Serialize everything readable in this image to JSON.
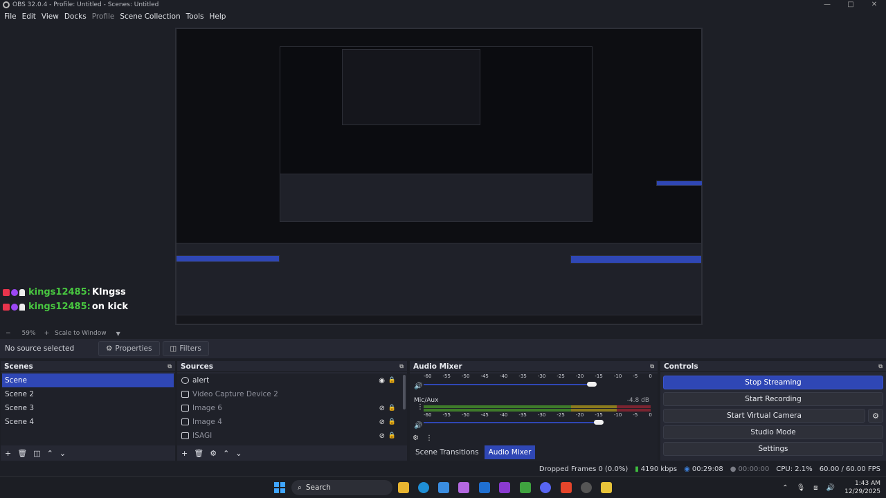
{
  "window": {
    "title": "OBS 32.0.4 - Profile: Untitled - Scenes: Untitled",
    "controls": [
      "—",
      "□",
      "✕"
    ]
  },
  "menu": [
    "File",
    "Edit",
    "View",
    "Docks",
    "Profile",
    "Scene Collection",
    "Tools",
    "Help"
  ],
  "chat": [
    {
      "user": "kings12485:",
      "message": "KIngss"
    },
    {
      "user": "kings12485:",
      "message": "on kick"
    }
  ],
  "scale": {
    "minus": "−",
    "zoom": "59%",
    "plus": "+",
    "mode": "Scale to Window"
  },
  "source_bar": {
    "no_source": "No source selected",
    "properties": "Properties",
    "filters": "Filters"
  },
  "scenes": {
    "title": "Scenes",
    "items": [
      "Scene",
      "Scene 2",
      "Scene 3",
      "Scene 4"
    ]
  },
  "sources": {
    "title": "Sources",
    "items": [
      "alert",
      "Video Capture Device 2",
      "Image 6",
      "Image 4",
      "ISAGI"
    ]
  },
  "mixer": {
    "title": "Audio Mixer",
    "ticks": [
      "-60",
      "-55",
      "-50",
      "-45",
      "-40",
      "-35",
      "-30",
      "-25",
      "-20",
      "-15",
      "-10",
      "-5",
      "0"
    ],
    "channel": {
      "name": "Mic/Aux",
      "db": "-4.8 dB"
    },
    "tab_transitions": "Scene Transitions",
    "tab_mixer": "Audio Mixer"
  },
  "controls": {
    "title": "Controls",
    "stop_streaming": "Stop Streaming",
    "start_recording": "Start Recording",
    "start_virtual_camera": "Start Virtual Camera",
    "studio_mode": "Studio Mode",
    "settings": "Settings"
  },
  "status": {
    "dropped": "Dropped Frames 0 (0.0%)",
    "bitrate": "4190 kbps",
    "stream_time": "00:29:08",
    "rec_time": "00:00:00",
    "cpu": "CPU: 2.1%",
    "fps": "60.00 / 60.00 FPS"
  },
  "taskbar": {
    "search": "Search",
    "time": "1:43 AM",
    "date": "12/29/2025"
  },
  "colors": {
    "accent": "#2f47b5",
    "chat_user": "#48c640"
  }
}
